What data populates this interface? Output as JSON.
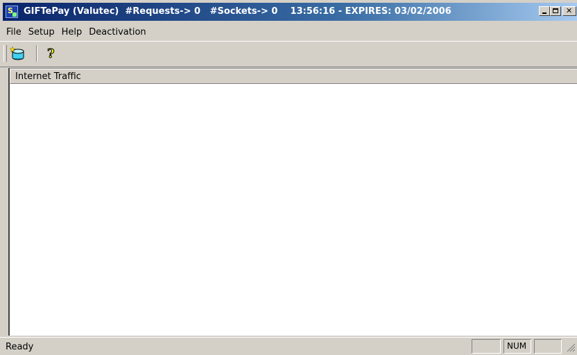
{
  "window": {
    "title": "GIFTePay (Valutec)  #Requests-> 0   #Sockets-> 0    13:56:16 - EXPIRES: 03/02/2006",
    "app_icon": "app-icon"
  },
  "menu": {
    "items": [
      "File",
      "Setup",
      "Help",
      "Deactivation"
    ]
  },
  "toolbar": {
    "buttons": [
      {
        "icon": "new-connection-icon"
      },
      {
        "icon": "help-question-icon"
      }
    ]
  },
  "list": {
    "column_header": "Internet Traffic"
  },
  "status": {
    "text": "Ready",
    "num_indicator": "NUM"
  },
  "colors": {
    "title_gradient_start": "#0a246a",
    "title_gradient_end": "#a6caf0",
    "chrome": "#d4d0c8"
  }
}
